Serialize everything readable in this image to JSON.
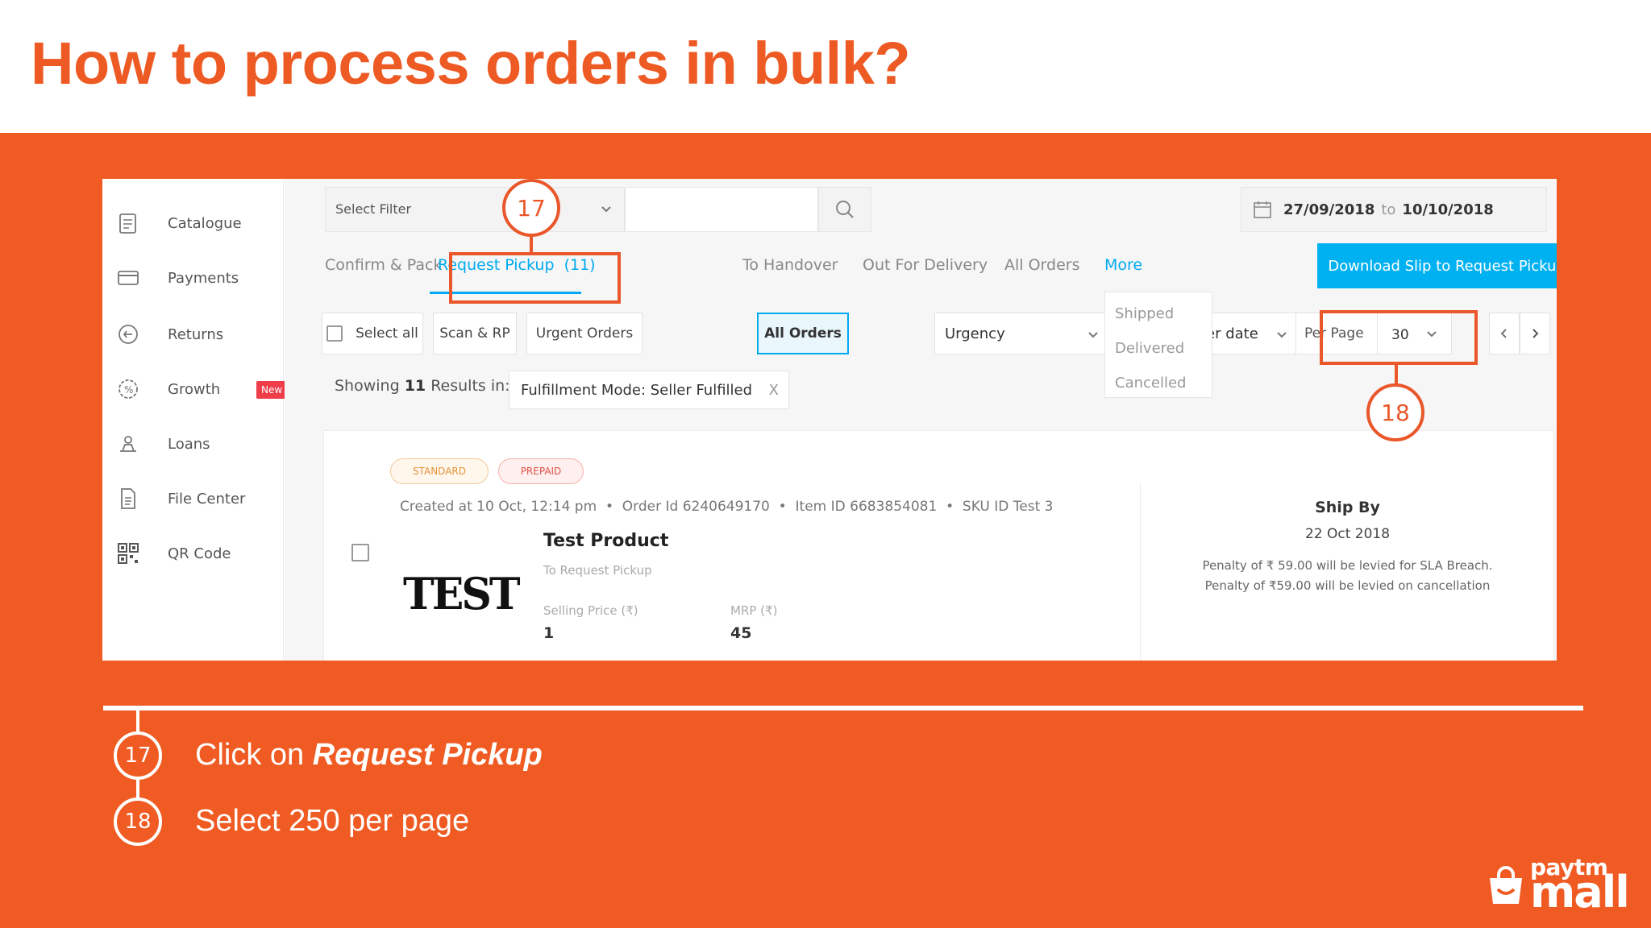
{
  "slide": {
    "title": "How to process orders in bulk?",
    "brand_top": "paytm",
    "brand_bottom": "mall",
    "colors": {
      "accent": "#ef5b22",
      "link": "#00aaf0",
      "white": "#ffffff"
    }
  },
  "sidebar": {
    "items": [
      {
        "label": "Catalogue",
        "icon": "catalogue-icon"
      },
      {
        "label": "Payments",
        "icon": "card-icon"
      },
      {
        "label": "Returns",
        "icon": "returns-icon"
      },
      {
        "label": "Growth",
        "icon": "growth-icon",
        "badge": "New"
      },
      {
        "label": "Loans",
        "icon": "loans-icon"
      },
      {
        "label": "File Center",
        "icon": "file-icon"
      },
      {
        "label": "QR Code",
        "icon": "qr-icon"
      }
    ]
  },
  "toolbar": {
    "filter_placeholder": "Select Filter",
    "date_from": "27/09/2018",
    "date_to_word": "to",
    "date_to": "10/10/2018"
  },
  "tabs": [
    {
      "label": "Confirm & Pack"
    },
    {
      "label": "Request Pickup  (11)",
      "active": true
    },
    {
      "label": "To Handover"
    },
    {
      "label": "Out For Delivery"
    },
    {
      "label": "All Orders"
    },
    {
      "label": "More"
    }
  ],
  "more_menu": [
    "Shipped",
    "Delivered",
    "Cancelled"
  ],
  "download_button": "Download Slip to Request Pickup (.pdf)",
  "filters": {
    "select_all": "Select all",
    "scan_rp": "Scan & RP",
    "urgent_orders": "Urgent Orders",
    "all_orders": "All Orders",
    "urgency": "Urgency",
    "order_date": "er date",
    "per_page_label": "Per Page",
    "per_page_value": "30"
  },
  "results": {
    "prefix": "Showing",
    "count": "11",
    "suffix": "Results in:",
    "chip": "Fulfillment Mode: Seller Fulfilled",
    "chip_close": "X"
  },
  "order": {
    "badge_standard": "STANDARD",
    "badge_prepaid": "PREPAID",
    "meta": "Created at 10 Oct, 12:14 pm  •  Order Id 6240649170  •  Item ID 6683854081  •  SKU ID Test 3",
    "logo_text": "TEST",
    "product_name": "Test Product",
    "status": "To Request Pickup",
    "selling_price_label": "Selling Price (₹)",
    "selling_price": "1",
    "mrp_label": "MRP (₹)",
    "mrp": "45",
    "ship_by_label": "Ship By",
    "ship_by_date": "22 Oct 2018",
    "penalty_sla": "Penalty of ₹ 59.00 will be levied for SLA Breach.",
    "penalty_cancel": "Penalty of ₹59.00 will be levied on cancellation"
  },
  "annotations": {
    "callout_a": "17",
    "callout_b": "18"
  },
  "steps": [
    {
      "number": "17",
      "text_prefix": "Click on ",
      "text_bold": "Request Pickup"
    },
    {
      "number": "18",
      "text_prefix": "Select 250 per page",
      "text_bold": ""
    }
  ]
}
